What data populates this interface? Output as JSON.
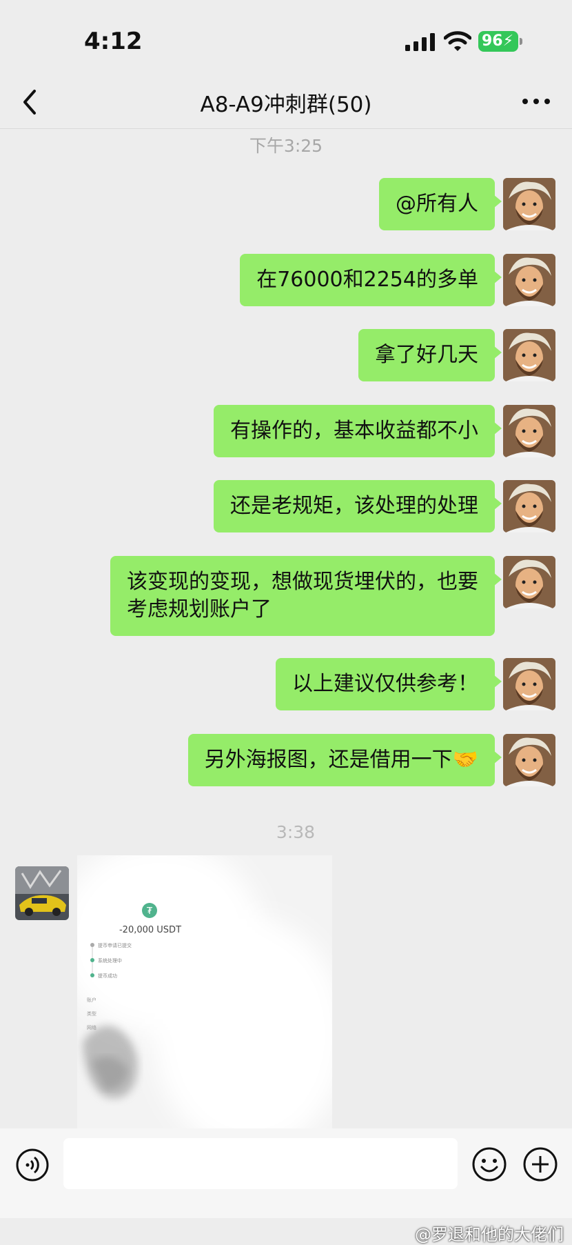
{
  "status_bar": {
    "time": "4:12",
    "battery": "96"
  },
  "header": {
    "title": "A8-A9冲刺群(50)"
  },
  "timestamps": [
    "下午3:25",
    "3:38"
  ],
  "messages": [
    {
      "text": "@所有人"
    },
    {
      "text": "在76000和2254的多单"
    },
    {
      "text": "拿了好几天"
    },
    {
      "text": "有操作的，基本收益都不小"
    },
    {
      "text": "还是老规矩，该处理的处理"
    },
    {
      "text": "该变现的变现，想做现货埋伏的，也要考虑规划账户了"
    },
    {
      "text": "以上建议仅供参考！"
    },
    {
      "text": "另外海报图，还是借用一下🤝"
    }
  ],
  "image_message": {
    "amount": "-20,000 USDT",
    "steps": [
      "提币申请已提交",
      "系统处理中",
      "提币成功"
    ],
    "fields": [
      "账户",
      "类型",
      "网络"
    ]
  },
  "watermark": "@罗退和他的大佬们",
  "colors": {
    "bubble": "#95ec69",
    "background": "#ededed"
  }
}
